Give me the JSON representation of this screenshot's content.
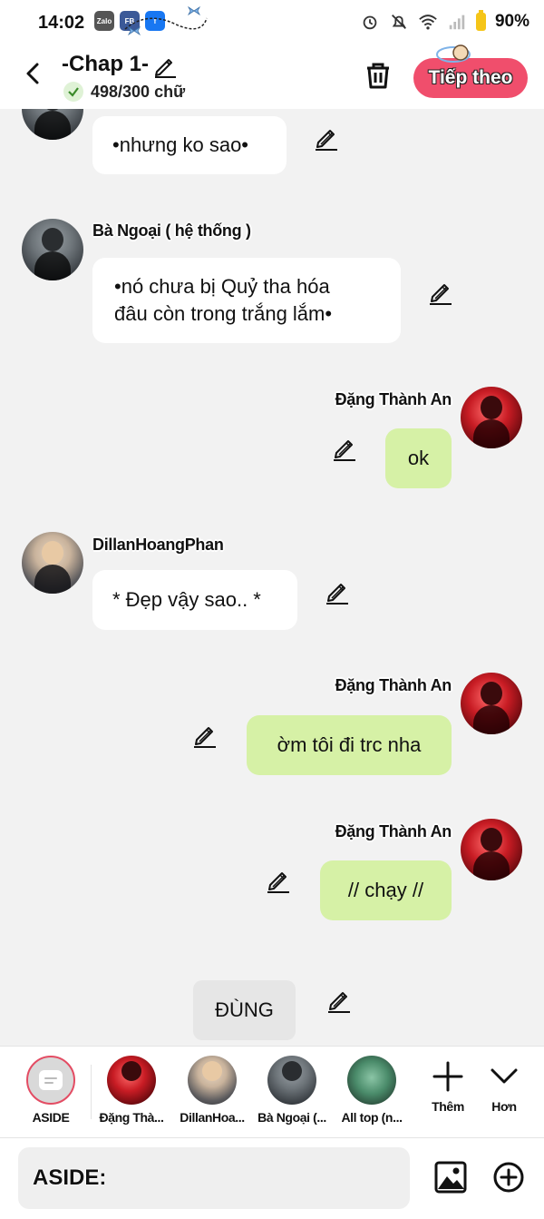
{
  "status_bar": {
    "time": "14:02",
    "apps": [
      "Zalo",
      "FB",
      "f"
    ],
    "battery": "90%"
  },
  "header": {
    "title": "-Chap 1-",
    "word_count": "498/300 chữ",
    "next_label": "Tiếp theo"
  },
  "messages": [
    {
      "speaker": "",
      "text": "•nhưng ko sao•",
      "side": "left"
    },
    {
      "speaker": "Bà Ngoại ( hệ thống )",
      "text_lines": [
        "•nó chưa bị Quỷ tha hóa",
        "đâu còn trong trắng lắm•"
      ],
      "side": "left"
    },
    {
      "speaker": "Đặng Thành An",
      "text": "ok",
      "side": "right"
    },
    {
      "speaker": "DillanHoangPhan",
      "text": "* Đẹp vậy sao.. *",
      "side": "left"
    },
    {
      "speaker": "Đặng Thành An",
      "text": "ờm tôi đi trc nha",
      "side": "right"
    },
    {
      "speaker": "Đặng Thành An",
      "text": "// chạy //",
      "side": "right"
    },
    {
      "speaker": "",
      "text": "ĐÙNG",
      "side": "aside"
    }
  ],
  "character_bar": {
    "items": [
      {
        "label": "ASIDE"
      },
      {
        "label": "Đặng Thà..."
      },
      {
        "label": "DillanHoa..."
      },
      {
        "label": "Bà Ngoại (..."
      },
      {
        "label": "All top (n..."
      }
    ],
    "add_label": "Thêm",
    "more_label": "Hơn"
  },
  "input": {
    "value": "ASIDE:"
  },
  "colors": {
    "accent_pink": "#f04e6c",
    "bubble_green": "#d6f1a6",
    "background": "#f2f2f2"
  }
}
